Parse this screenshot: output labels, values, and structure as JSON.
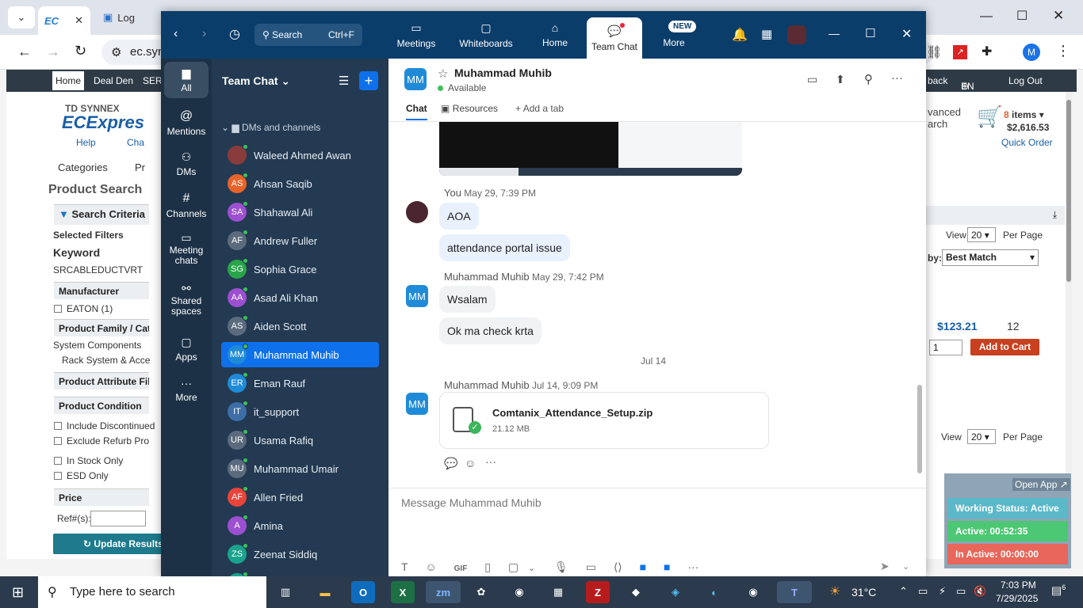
{
  "browser": {
    "tabs": [
      {
        "label": "EC",
        "close": "✕"
      },
      {
        "label": "Log"
      }
    ],
    "address": "ec.syn",
    "profile": "M"
  },
  "site": {
    "nav": {
      "home": "Home",
      "deal_den": "Deal Den",
      "ser": "SER",
      "back": "back",
      "lang": "EN",
      "logout": "Log Out"
    },
    "logo_top": "TD SYNNEX",
    "logo_main": "ECExpres",
    "help": "Help",
    "chat": "Cha",
    "categories": "Categories",
    "pr": "Pr",
    "product_search": "Product Search",
    "search_criteria": "Search Criteria",
    "selected_filters": "Selected Filters",
    "keyword_label": "Keyword",
    "keyword_value": "SRCABLEDUCTVRT",
    "manufacturer": "Manufacturer",
    "eaton": "EATON (1)",
    "product_family": "Product Family / Categ",
    "system_components": "System Components",
    "rack_system": "Rack System & Acce",
    "product_attribute": "Product Attribute Filte",
    "product_condition": "Product Condition",
    "include_discontinued": "Include Discontinued",
    "exclude_refurb": "Exclude Refurb Pro",
    "in_stock": "In Stock Only",
    "esd": "ESD Only",
    "price": "Price",
    "ref": "Ref#(s):",
    "update": "Update Results",
    "advanced": "vanced",
    "search_word": "arch",
    "cart_count": "8",
    "cart_items": "items",
    "cart_total": "$2,616.53",
    "quick_order": "Quick Order",
    "view": "View",
    "per_page_value": "20",
    "per_page": "Per Page",
    "sort_by": "by:",
    "sort_value": "Best Match",
    "price_val": "$123.21",
    "qty": "12",
    "qty_input": "1",
    "add_to_cart": "Add to Cart"
  },
  "zoom": {
    "search_label": "Search",
    "search_shortcut": "Ctrl+F",
    "tabs": [
      "Meetings",
      "Whiteboards",
      "Home",
      "Team Chat",
      "More"
    ],
    "new_badge": "NEW",
    "rail": [
      "All",
      "Mentions",
      "DMs",
      "Channels",
      "Meeting chats",
      "Shared spaces",
      "Apps",
      "More"
    ],
    "list_title": "Team Chat",
    "section": "DMs and channels",
    "contacts": [
      {
        "init": "",
        "name": "Waleed Ahmed Awan",
        "color": "#8a3b3b"
      },
      {
        "init": "AS",
        "name": "Ahsan Saqib",
        "color": "#e8632a"
      },
      {
        "init": "SA",
        "name": "Shahawal Ali",
        "color": "#9c4fd1"
      },
      {
        "init": "AF",
        "name": "Andrew Fuller",
        "color": "#5b6b7d"
      },
      {
        "init": "SG",
        "name": "Sophia Grace",
        "color": "#2aa44a"
      },
      {
        "init": "AA",
        "name": "Asad Ali Khan",
        "color": "#9c4fd1"
      },
      {
        "init": "AS",
        "name": "Aiden Scott",
        "color": "#5b6b7d"
      },
      {
        "init": "MM",
        "name": "Muhammad Muhib",
        "color": "#1f8bd8"
      },
      {
        "init": "ER",
        "name": "Eman Rauf",
        "color": "#1f8bd8"
      },
      {
        "init": "IT",
        "name": "it_support",
        "color": "#3e6ea8"
      },
      {
        "init": "UR",
        "name": "Usama Rafiq",
        "color": "#5b6b7d"
      },
      {
        "init": "MU",
        "name": "Muhammad Umair",
        "color": "#5b6b7d"
      },
      {
        "init": "AF",
        "name": "Allen Fried",
        "color": "#e8443a"
      },
      {
        "init": "A",
        "name": "Amina",
        "color": "#9c4fd1"
      },
      {
        "init": "ZS",
        "name": "Zeenat Siddiq",
        "color": "#1aa38c"
      },
      {
        "init": "WA",
        "name": "Waleed Ayub",
        "color": "#1aa38c"
      }
    ],
    "chat": {
      "name": "Muhammad Muhib",
      "initials": "MM",
      "status": "Available",
      "tabs": [
        "Chat",
        "Resources",
        "Add a tab"
      ],
      "msgs": [
        {
          "sender": "You",
          "time": "May 29, 7:39 PM",
          "lines": [
            "AOA",
            "attendance portal issue"
          ]
        },
        {
          "sender": "Muhammad Muhib",
          "time": "May 29, 7:42 PM",
          "lines": [
            "Wsalam",
            "Ok ma check krta"
          ]
        }
      ],
      "date_sep": "Jul 14",
      "file_msg": {
        "sender": "Muhammad Muhib",
        "time": "Jul 14, 9:09 PM",
        "file_name": "Comtanix_Attendance_Setup.zip",
        "file_size": "21.12 MB"
      },
      "composer_placeholder": "Message Muhammad Muhib",
      "gif": "GIF"
    }
  },
  "status_panel": {
    "open_app": "Open App ↗",
    "working": "Working Status: Active",
    "active": "Active: 00:52:35",
    "inactive": "In Active: 00:00:00"
  },
  "taskbar": {
    "search": "Type here to search",
    "temp": "31°C",
    "time": "7:03 PM",
    "date": "7/29/2025",
    "notif": "6"
  }
}
